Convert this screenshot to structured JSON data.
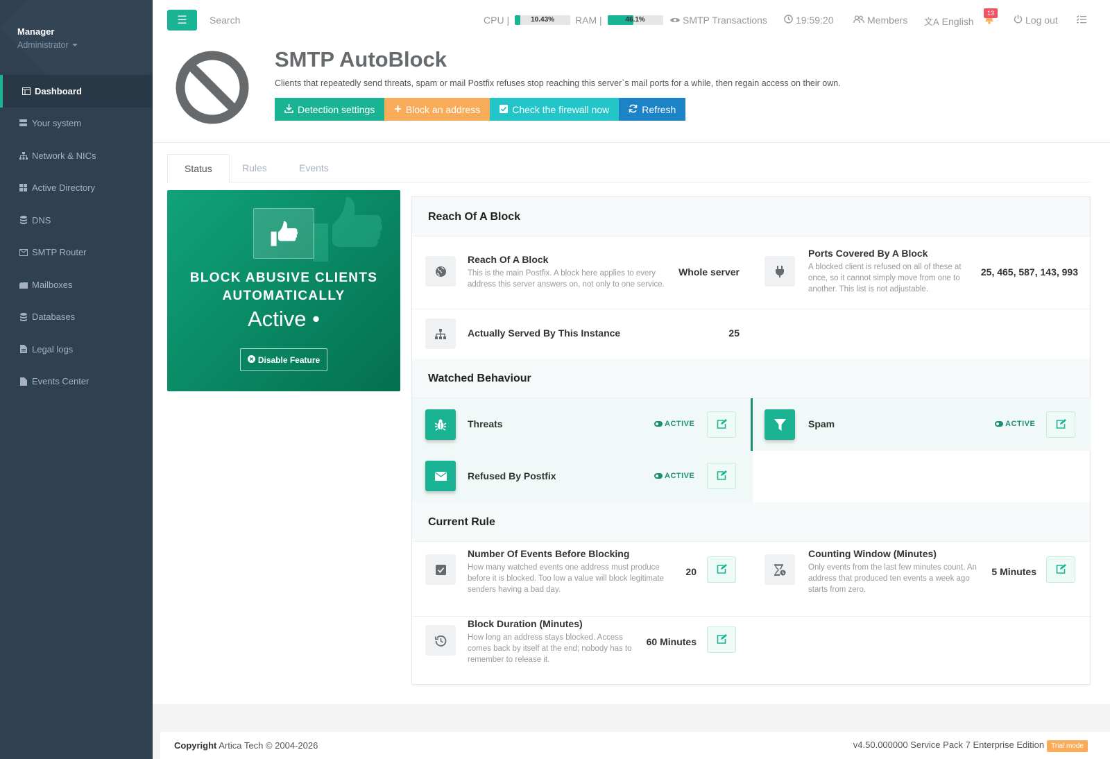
{
  "sidebar": {
    "user": "Manager",
    "role": "Administrator",
    "items": [
      {
        "label": "Dashboard",
        "icon": "dashboard-icon"
      },
      {
        "label": "Your system",
        "icon": "server-icon"
      },
      {
        "label": "Network & NICs",
        "icon": "network-icon"
      },
      {
        "label": "Active Directory",
        "icon": "windows-icon"
      },
      {
        "label": "DNS",
        "icon": "database-icon"
      },
      {
        "label": "SMTP Router",
        "icon": "envelope-icon"
      },
      {
        "label": "Mailboxes",
        "icon": "mailbox-icon"
      },
      {
        "label": "Databases",
        "icon": "database-icon"
      },
      {
        "label": "Legal logs",
        "icon": "file-icon"
      },
      {
        "label": "Events Center",
        "icon": "file-icon"
      }
    ]
  },
  "topbar": {
    "search_placeholder": "Search",
    "cpu_label": "CPU |",
    "cpu_value": "10.43%",
    "cpu_fraction": 0.1043,
    "ram_label": "RAM |",
    "ram_value": "46.1%",
    "ram_fraction": 0.461,
    "smtp_transactions": "SMTP Transactions",
    "time": "19:59:20",
    "members": "Members",
    "language": "English",
    "notifications": "13",
    "logout": "Log out"
  },
  "header": {
    "title": "SMTP AutoBlock",
    "subtitle": "Clients that repeatedly send threats, spam or mail Postfix refuses stop reaching this server`s mail ports for a while, then regain access on their own.",
    "buttons": {
      "detection": "Detection settings",
      "block": "Block an address",
      "check": "Check the firewall now",
      "refresh": "Refresh"
    }
  },
  "tabs": [
    "Status",
    "Rules",
    "Events"
  ],
  "promo": {
    "title_line1": "BLOCK ABUSIVE CLIENTS",
    "title_line2": "AUTOMATICALLY",
    "status": "Active •",
    "button": "Disable Feature"
  },
  "reach": {
    "section": "Reach Of A Block",
    "reach_label": "Reach Of A Block",
    "reach_desc": "This is the main Postfix. A block here applies to every address this server answers on, not only to one service.",
    "reach_value": "Whole server",
    "ports_label": "Ports Covered By A Block",
    "ports_desc": "A blocked client is refused on all of these at once, so it cannot simply move from one to another. This list is not adjustable.",
    "ports_value": "25, 465, 587, 143, 993",
    "served_label": "Actually Served By This Instance",
    "served_value": "25"
  },
  "watched": {
    "section": "Watched Behaviour",
    "items": [
      {
        "label": "Threats",
        "status": "ACTIVE"
      },
      {
        "label": "Spam",
        "status": "ACTIVE"
      },
      {
        "label": "Refused By Postfix",
        "status": "ACTIVE"
      }
    ]
  },
  "rule": {
    "section": "Current Rule",
    "events_label": "Number Of Events Before Blocking",
    "events_desc": "How many watched events one address must produce before it is blocked. Too low a value will block legitimate senders having a bad day.",
    "events_value": "20",
    "window_label": "Counting Window (Minutes)",
    "window_desc": "Only events from the last few minutes count. An address that produced ten events a week ago starts from zero.",
    "window_value": "5 Minutes",
    "duration_label": "Block Duration (Minutes)",
    "duration_desc": "How long an address stays blocked. Access comes back by itself at the end; nobody has to remember to release it.",
    "duration_value": "60 Minutes"
  },
  "footer": {
    "copyright_bold": "Copyright",
    "copyright": "Artica Tech © 2004-2026",
    "version": "v4.50.000000 Service Pack 7 Enterprise Edition",
    "trial": "Trial mode"
  },
  "colors": {
    "accent": "#1ab394",
    "sidebar": "#2f4050",
    "orange": "#f8ac59",
    "cyan": "#23c6c8",
    "blue": "#1c84c6"
  }
}
